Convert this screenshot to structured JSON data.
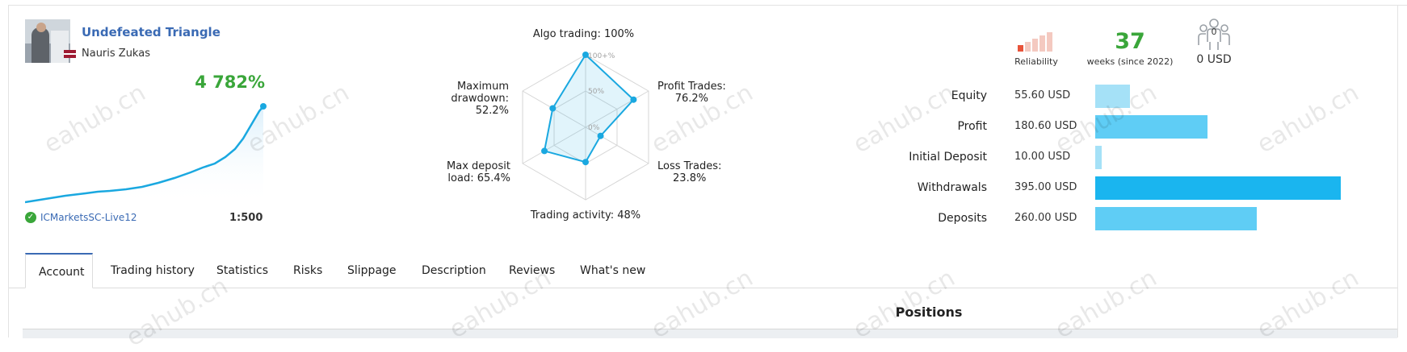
{
  "signal": {
    "title": "Undefeated Triangle",
    "author": "Nauris Zukas",
    "growth": "4 782%",
    "broker": "ICMarketsSC-Live12",
    "leverage": "1:500"
  },
  "radar": {
    "labels": {
      "algo": "Algo trading: 100%",
      "profit": "Profit Trades:",
      "profit_val": "76.2%",
      "loss": "Loss Trades:",
      "loss_val": "23.8%",
      "activity": "Trading activity: 48%",
      "deposit_load": "Max deposit",
      "deposit_load_val": "load: 65.4%",
      "drawdown_1": "Maximum",
      "drawdown_2": "drawdown:",
      "drawdown_val": "52.2%"
    },
    "scale": {
      "s100": "100+%",
      "s50": "50%",
      "s0": "0%"
    },
    "values": {
      "algo_trading": 100,
      "profit_trades": 76.2,
      "loss_trades": 23.8,
      "trading_activity": 48,
      "max_deposit_load": 65.4,
      "max_drawdown": 52.2
    }
  },
  "summary": {
    "reliability_label": "Reliability",
    "weeks": "37",
    "weeks_label": "weeks (since 2022)",
    "subscribers_count": "0",
    "subscribers_label": "0 USD"
  },
  "metrics": [
    {
      "label": "Equity",
      "value": "55.60 USD",
      "amount": 55.6,
      "color": "#a5e1f7"
    },
    {
      "label": "Profit",
      "value": "180.60 USD",
      "amount": 180.6,
      "color": "#5fcdf5"
    },
    {
      "label": "Initial Deposit",
      "value": "10.00 USD",
      "amount": 10.0,
      "color": "#a5e1f7"
    },
    {
      "label": "Withdrawals",
      "value": "395.00 USD",
      "amount": 395.0,
      "color": "#1ab5ef"
    },
    {
      "label": "Deposits",
      "value": "260.00 USD",
      "amount": 260.0,
      "color": "#5fcdf5"
    }
  ],
  "tabs": [
    "Account",
    "Trading history",
    "Statistics",
    "Risks",
    "Slippage",
    "Description",
    "Reviews",
    "What's new"
  ],
  "positions_title": "Positions",
  "watermark": "eahub.cn",
  "colors": {
    "accent": "#3a6ab4",
    "positive": "#3aa63a",
    "radar": "#1aa8e0"
  }
}
